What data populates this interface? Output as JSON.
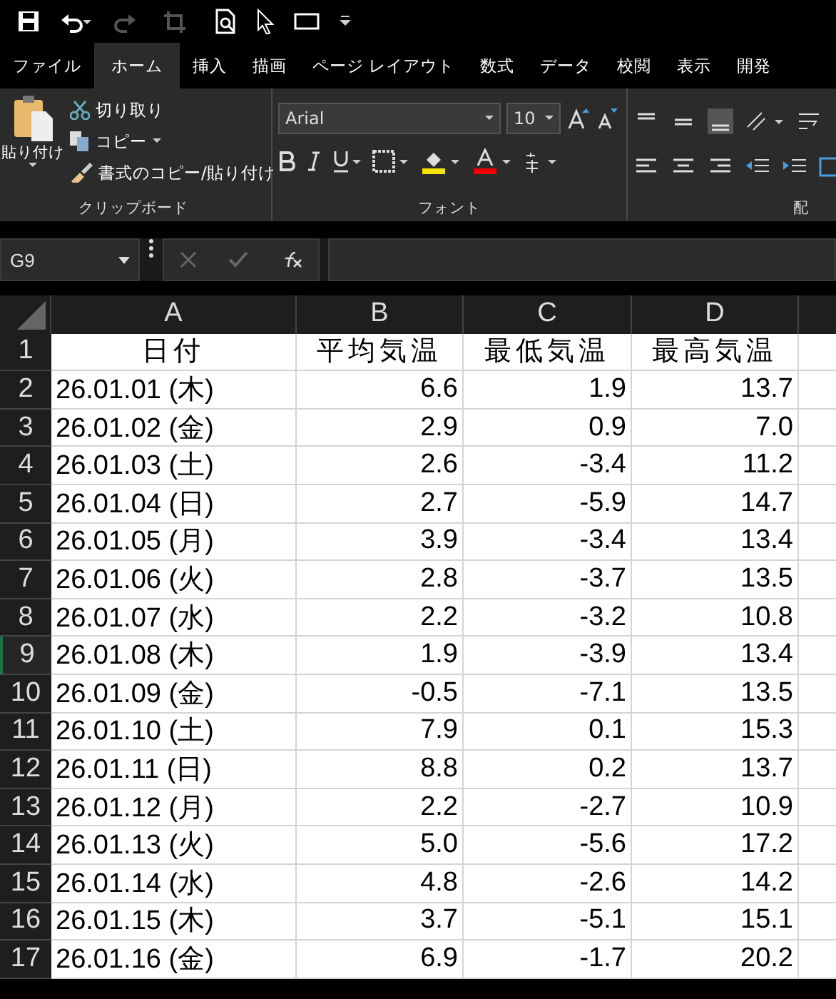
{
  "ribbon_tabs": [
    {
      "label": "ファイル",
      "selected": false
    },
    {
      "label": "ホーム",
      "selected": true
    },
    {
      "label": "挿入",
      "selected": false
    },
    {
      "label": "描画",
      "selected": false
    },
    {
      "label": "ページ レイアウト",
      "selected": false
    },
    {
      "label": "数式",
      "selected": false
    },
    {
      "label": "データ",
      "selected": false
    },
    {
      "label": "校閲",
      "selected": false
    },
    {
      "label": "表示",
      "selected": false
    },
    {
      "label": "開発",
      "selected": false
    }
  ],
  "clipboard": {
    "paste": "貼り付け",
    "cut": "切り取り",
    "copy": "コピー",
    "format_painter": "書式のコピー/貼り付け",
    "group_label": "クリップボード"
  },
  "font": {
    "font_name": "Arial",
    "font_size": "10",
    "group_label": "フォント"
  },
  "alignment": {
    "group_label": "配"
  },
  "name_box": "G9",
  "sheet": {
    "columns": [
      "A",
      "B",
      "C",
      "D"
    ],
    "rows": [
      {
        "number": "1",
        "cells": [
          "日付",
          "平均気温",
          "最低気温",
          "最高気温"
        ],
        "selected": false
      },
      {
        "number": "2",
        "cells": [
          "26.01.01 (木)",
          "6.6",
          "1.9",
          "13.7"
        ],
        "selected": false
      },
      {
        "number": "3",
        "cells": [
          "26.01.02 (金)",
          "2.9",
          "0.9",
          "7.0"
        ],
        "selected": false
      },
      {
        "number": "4",
        "cells": [
          "26.01.03 (土)",
          "2.6",
          "-3.4",
          "11.2"
        ],
        "selected": false
      },
      {
        "number": "5",
        "cells": [
          "26.01.04 (日)",
          "2.7",
          "-5.9",
          "14.7"
        ],
        "selected": false
      },
      {
        "number": "6",
        "cells": [
          "26.01.05 (月)",
          "3.9",
          "-3.4",
          "13.4"
        ],
        "selected": false
      },
      {
        "number": "7",
        "cells": [
          "26.01.06 (火)",
          "2.8",
          "-3.7",
          "13.5"
        ],
        "selected": false
      },
      {
        "number": "8",
        "cells": [
          "26.01.07 (水)",
          "2.2",
          "-3.2",
          "10.8"
        ],
        "selected": false
      },
      {
        "number": "9",
        "cells": [
          "26.01.08 (木)",
          "1.9",
          "-3.9",
          "13.4"
        ],
        "selected": true
      },
      {
        "number": "10",
        "cells": [
          "26.01.09 (金)",
          "-0.5",
          "-7.1",
          "13.5"
        ],
        "selected": false
      },
      {
        "number": "11",
        "cells": [
          "26.01.10 (土)",
          "7.9",
          "0.1",
          "15.3"
        ],
        "selected": false
      },
      {
        "number": "12",
        "cells": [
          "26.01.11 (日)",
          "8.8",
          "0.2",
          "13.7"
        ],
        "selected": false
      },
      {
        "number": "13",
        "cells": [
          "26.01.12 (月)",
          "2.2",
          "-2.7",
          "10.9"
        ],
        "selected": false
      },
      {
        "number": "14",
        "cells": [
          "26.01.13 (火)",
          "5.0",
          "-5.6",
          "17.2"
        ],
        "selected": false
      },
      {
        "number": "15",
        "cells": [
          "26.01.14 (水)",
          "4.8",
          "-2.6",
          "14.2"
        ],
        "selected": false
      },
      {
        "number": "16",
        "cells": [
          "26.01.15 (木)",
          "3.7",
          "-5.1",
          "15.1"
        ],
        "selected": false
      },
      {
        "number": "17",
        "cells": [
          "26.01.16 (金)",
          "6.9",
          "-1.7",
          "20.2"
        ],
        "selected": false
      }
    ]
  }
}
